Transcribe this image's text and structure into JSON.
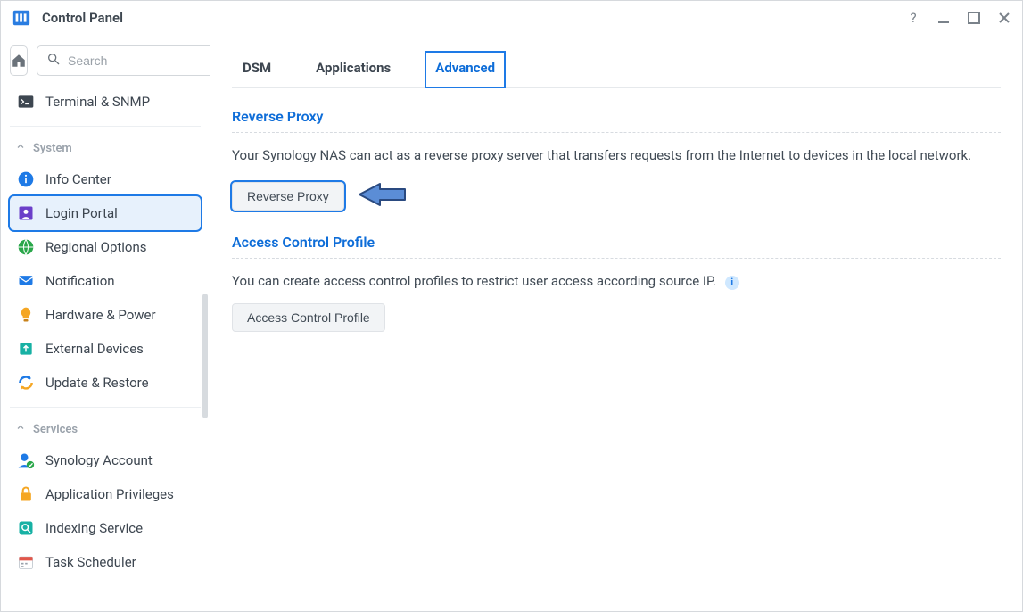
{
  "window": {
    "title": "Control Panel"
  },
  "titlebar": {
    "help_icon": "help-icon",
    "min_icon": "minimize-icon",
    "max_icon": "maximize-icon",
    "close_icon": "close-icon"
  },
  "sidebar": {
    "search_placeholder": "Search",
    "top_item": {
      "label": "Terminal & SNMP",
      "icon": "terminal-icon"
    },
    "groups": [
      {
        "name": "System",
        "items": [
          {
            "label": "Info Center",
            "icon": "info-icon",
            "icon_color": "#1e7ae6"
          },
          {
            "label": "Login Portal",
            "icon": "portal-icon",
            "icon_color": "#6b3fc9",
            "selected": true
          },
          {
            "label": "Regional Options",
            "icon": "globe-icon",
            "icon_color": "#2aa74a"
          },
          {
            "label": "Notification",
            "icon": "notification-icon",
            "icon_color": "#1e7ae6"
          },
          {
            "label": "Hardware & Power",
            "icon": "bulb-icon",
            "icon_color": "#f5a623"
          },
          {
            "label": "External Devices",
            "icon": "devices-icon",
            "icon_color": "#17b1a4"
          },
          {
            "label": "Update & Restore",
            "icon": "refresh-icon",
            "icon_color": "#1e7ae6"
          }
        ]
      },
      {
        "name": "Services",
        "items": [
          {
            "label": "Synology Account",
            "icon": "account-icon",
            "icon_color": "#1e7ae6"
          },
          {
            "label": "Application Privileges",
            "icon": "lock-icon",
            "icon_color": "#f5a623"
          },
          {
            "label": "Indexing Service",
            "icon": "index-icon",
            "icon_color": "#17b1a4"
          },
          {
            "label": "Task Scheduler",
            "icon": "calendar-icon",
            "icon_color": "#e2564a"
          }
        ]
      }
    ]
  },
  "main": {
    "tabs": [
      {
        "label": "DSM",
        "active": false
      },
      {
        "label": "Applications",
        "active": false
      },
      {
        "label": "Advanced",
        "active": true
      }
    ],
    "sections": [
      {
        "title": "Reverse Proxy",
        "desc": "Your Synology NAS can act as a reverse proxy server that transfers requests from the Internet to devices in the local network.",
        "button": "Reverse Proxy",
        "button_highlight": true,
        "arrow": true
      },
      {
        "title": "Access Control Profile",
        "desc": "You can create access control profiles to restrict user access according source IP.",
        "button": "Access Control Profile",
        "info": true
      }
    ]
  },
  "colors": {
    "accent": "#1e7ae6",
    "link": "#0e6dd8"
  }
}
